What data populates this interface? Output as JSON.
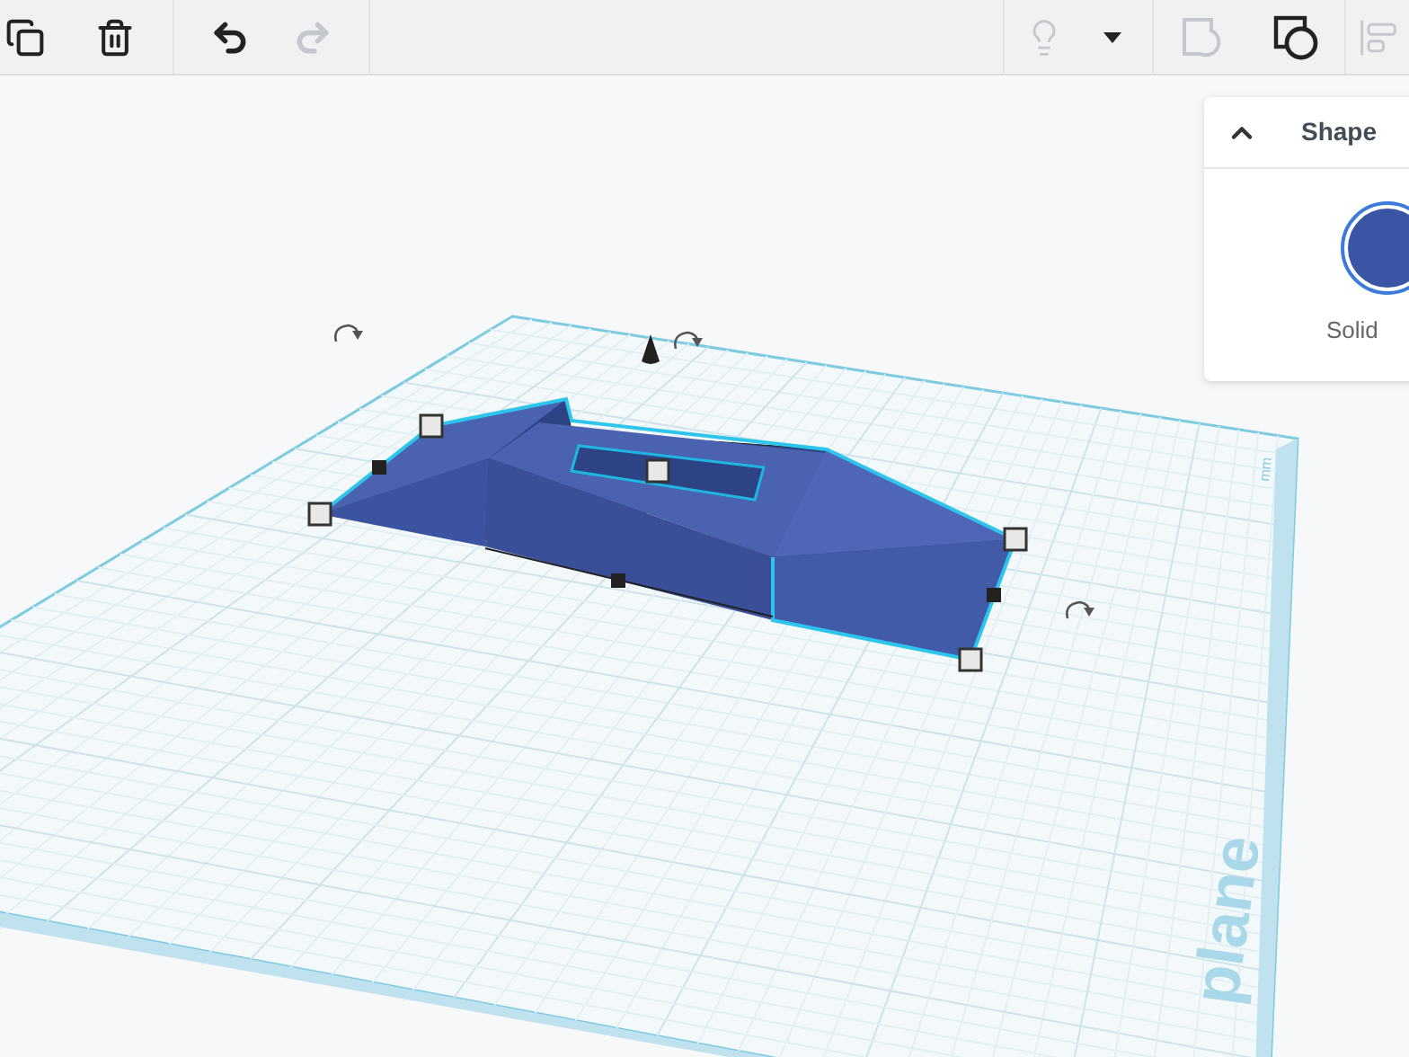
{
  "toolbar": [
    {
      "kind": "duplicate",
      "disabled": false
    },
    {
      "kind": "delete",
      "disabled": false
    },
    {
      "kind": "undo",
      "disabled": false
    },
    {
      "kind": "redo",
      "disabled": true
    },
    {
      "kind": "light",
      "disabled": true
    },
    {
      "kind": "dropdown",
      "disabled": false
    },
    {
      "kind": "hole",
      "disabled": true
    },
    {
      "kind": "solid",
      "disabled": false
    },
    {
      "kind": "align",
      "disabled": true
    }
  ],
  "shape_panel": {
    "title": "Shape",
    "expanded": true,
    "options": [
      {
        "label": "Solid",
        "color": "#3a55a4",
        "selected": true
      }
    ]
  },
  "workplane": {
    "label": "plane",
    "units": "mm"
  }
}
